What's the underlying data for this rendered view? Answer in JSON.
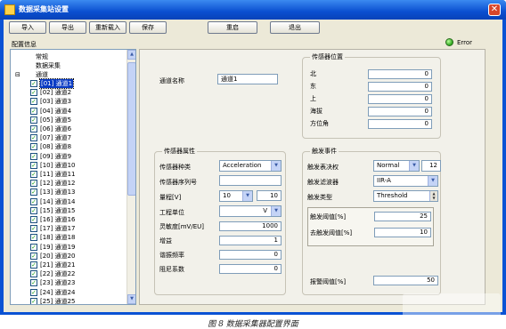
{
  "window": {
    "title": "数据采集站设置"
  },
  "toolbar": {
    "import_label": "导入",
    "export_label": "导出",
    "reload_label": "重新载入",
    "save_label": "保存",
    "restart_label": "重启",
    "exit_label": "退出"
  },
  "status": {
    "text": "Error",
    "color": "#2ba51b"
  },
  "config": {
    "label": "配置信息"
  },
  "tree": {
    "general": "常规",
    "acquisition": "数据采集",
    "channels_root": "通道",
    "expander": "⊟",
    "channels": [
      "[01] 通道1",
      "[02] 通道2",
      "[03] 通道3",
      "[04] 通道4",
      "[05] 通道5",
      "[06] 通道6",
      "[07] 通道7",
      "[08] 通道8",
      "[09] 通道9",
      "[10] 通道10",
      "[11] 通道11",
      "[12] 通道12",
      "[13] 通道13",
      "[14] 通道14",
      "[15] 通道15",
      "[16] 通道16",
      "[17] 通道17",
      "[18] 通道18",
      "[19] 通道19",
      "[20] 通道20",
      "[21] 通道21",
      "[22] 通道22",
      "[23] 通道23",
      "[24] 通道24",
      "[25] 通道25"
    ],
    "selected_index": 0
  },
  "channel": {
    "name_label": "通道名称",
    "name_value": "通道1"
  },
  "position": {
    "title": "传感器位置",
    "north_label": "北",
    "north_value": "0",
    "east_label": "东",
    "east_value": "0",
    "up_label": "上",
    "up_value": "0",
    "altitude_label": "海拔",
    "altitude_value": "0",
    "azimuth_label": "方位角",
    "azimuth_value": "0"
  },
  "sensor": {
    "title": "传感器属性",
    "type_label": "传感器种类",
    "type_value": "Acceleration",
    "serial_label": "传感器序列号",
    "serial_value": "",
    "range_label": "量程[V]",
    "range_value": "10",
    "range_value2": "10",
    "unit_label": "工程单位",
    "unit_value": "V",
    "sensitivity_label": "灵敏度[mV/EU]",
    "sensitivity_value": "1000",
    "gain_label": "增益",
    "gain_value": "1",
    "resonance_label": "谐振频率",
    "resonance_value": "0",
    "damping_label": "阻尼系数",
    "damping_value": "0"
  },
  "trigger": {
    "title": "触发事件",
    "vote_label": "触发表决权",
    "vote_mode": "Normal",
    "vote_value": "12",
    "filter_label": "触发滤波器",
    "filter_value": "IIR-A",
    "type_label": "触发类型",
    "type_value": "Threshold",
    "threshold_label": "触发阈值[%]",
    "threshold_value": "25",
    "detrigger_label": "去触发阈值[%]",
    "detrigger_value": "10",
    "alarm_label": "报警阈值[%]",
    "alarm_value": "50"
  },
  "caption": "图 8  数据采集器配置界面"
}
